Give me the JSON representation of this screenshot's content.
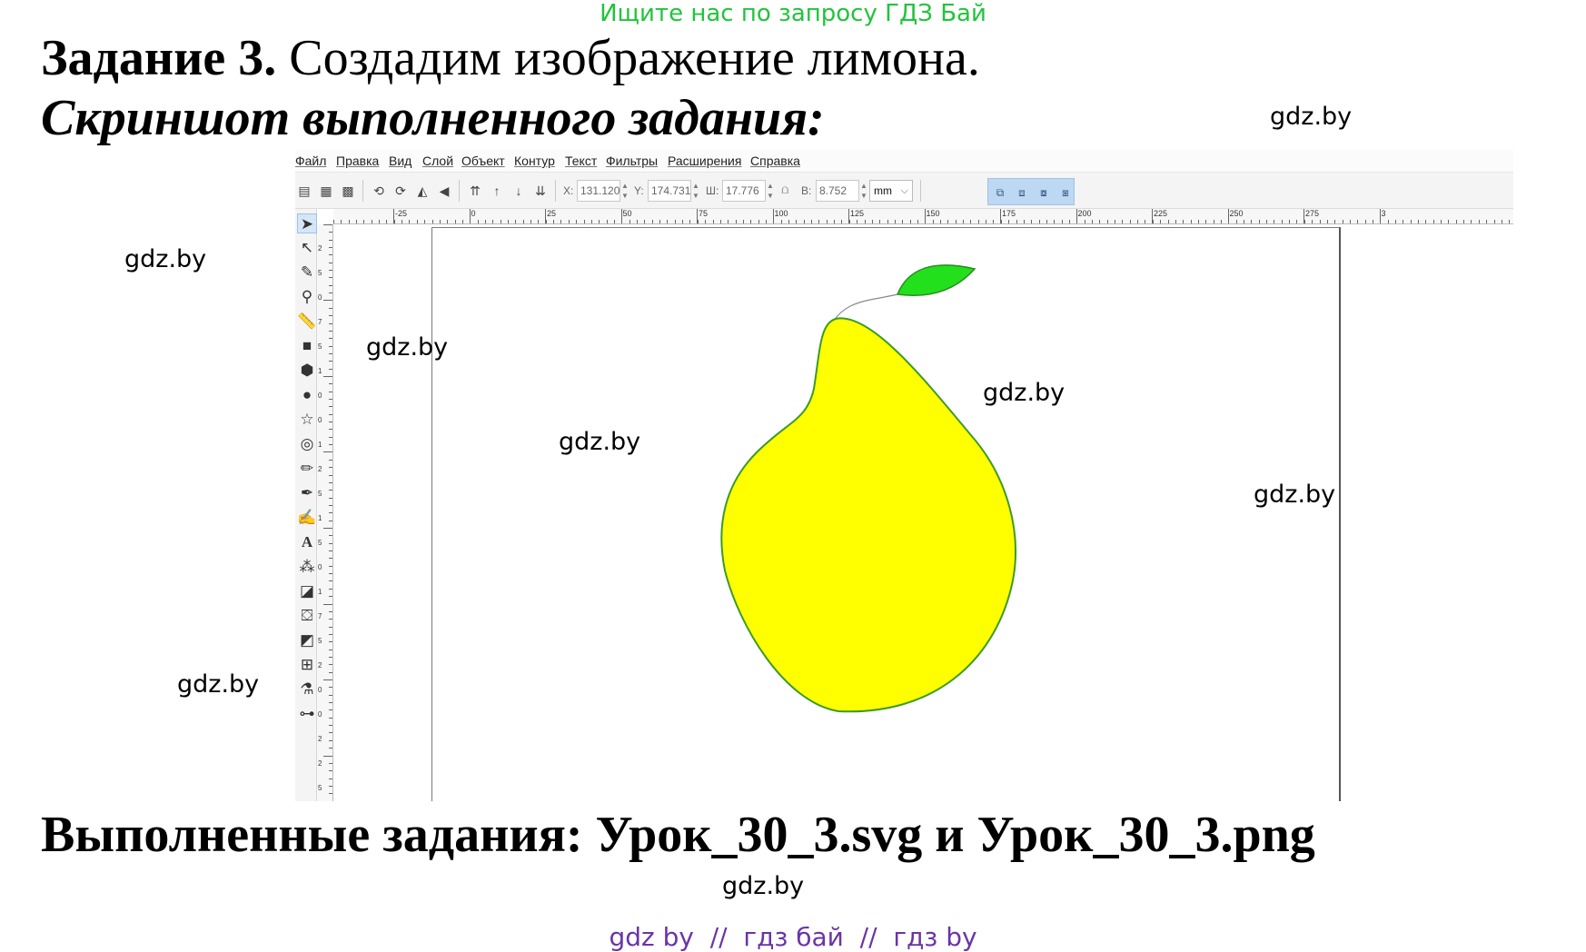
{
  "banner": "Ищите нас по запросу ГДЗ Бай",
  "task": {
    "lead": "Задание 3.",
    "text": "Создадим изображение лимона."
  },
  "screenshot_caption": "Скриншот выполненного задания:",
  "completed": "Выполненные задания: Урок_30_3.svg и Урок_30_3.png",
  "watermark": "gdz.by",
  "footer": "gdz by  //  гдз бай  //  гдз by",
  "colors": {
    "banner": "#22c43b",
    "footer": "#6a34a8",
    "lemon_fill": "#ffff00",
    "lemon_stroke": "#3c9a28",
    "leaf_fill": "#22e01c",
    "leaf_stroke": "#2c8a22",
    "snap_highlight": "#bcd8f3"
  },
  "app": {
    "menu": [
      "Файл",
      "Правка",
      "Вид",
      "Слой",
      "Объект",
      "Контур",
      "Текст",
      "Фильтры",
      "Расширения",
      "Справка"
    ],
    "toolbar": {
      "x_label": "X:",
      "x_value": "131.120",
      "y_label": "Y:",
      "y_value": "174.731",
      "w_label": "Ш:",
      "w_value": "17.776",
      "h_label": "В:",
      "h_value": "8.752",
      "unit": "mm"
    },
    "ruler_h_labels": [
      "-25",
      "0",
      "25",
      "50",
      "75",
      "100",
      "125",
      "150",
      "175",
      "200",
      "225",
      "250",
      "275",
      "3"
    ],
    "ruler_v_labels": [
      "2",
      "5",
      "0",
      "7",
      "5",
      "1",
      "0",
      "0",
      "1",
      "2",
      "5",
      "1",
      "5",
      "0",
      "1",
      "7",
      "5",
      "2",
      "0",
      "0",
      "2",
      "2",
      "5"
    ],
    "tools": [
      "selector-arrow-icon",
      "node-editor-icon",
      "tweak-icon",
      "zoom-icon",
      "measure-icon",
      "rectangle-icon",
      "box-3d-icon",
      "ellipse-icon",
      "star-icon",
      "spiral-icon",
      "pencil-icon",
      "pen-icon",
      "calligraphy-icon",
      "text-icon",
      "spray-icon",
      "eraser-icon",
      "paint-bucket-icon",
      "gradient-icon",
      "mesh-icon",
      "dropper-icon",
      "connector-icon"
    ]
  }
}
